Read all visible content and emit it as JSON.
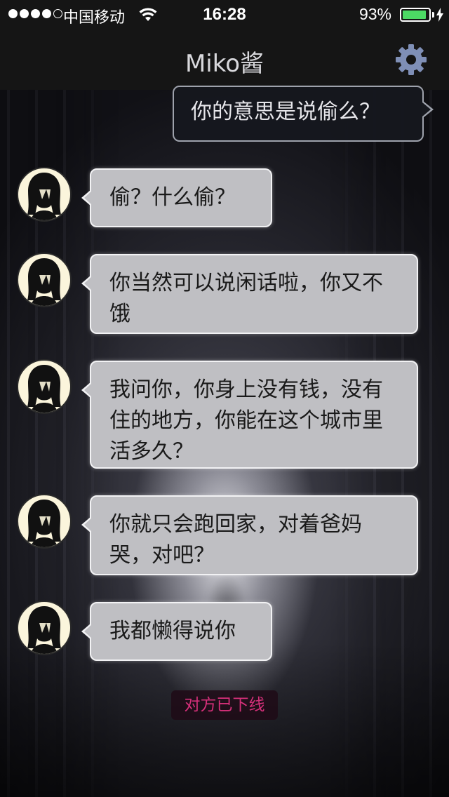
{
  "status_bar": {
    "carrier": "中国移动",
    "time": "16:28",
    "battery_percent": "93%",
    "battery_level": 0.93,
    "signal_strength": 4,
    "signal_max": 5
  },
  "nav": {
    "title": "Miko酱",
    "settings_icon": "gear-icon"
  },
  "messages": [
    {
      "direction": "outgoing",
      "text": "你的意思是说偷么？"
    },
    {
      "direction": "incoming",
      "text": "偷？什么偷？"
    },
    {
      "direction": "incoming",
      "text": "你当然可以说闲话啦，你又不饿"
    },
    {
      "direction": "incoming",
      "text": "我问你，你身上没有钱，没有住的地方，你能在这个城市里活多久？"
    },
    {
      "direction": "incoming",
      "text": "你就只会跑回家，对着爸妈哭，对吧？"
    },
    {
      "direction": "incoming",
      "text": "我都懒得说你"
    }
  ],
  "status_notice": "对方已下线",
  "colors": {
    "accent_icon": "#7f8fb6",
    "offline_text": "#d6307a",
    "battery": "#4cd964"
  }
}
